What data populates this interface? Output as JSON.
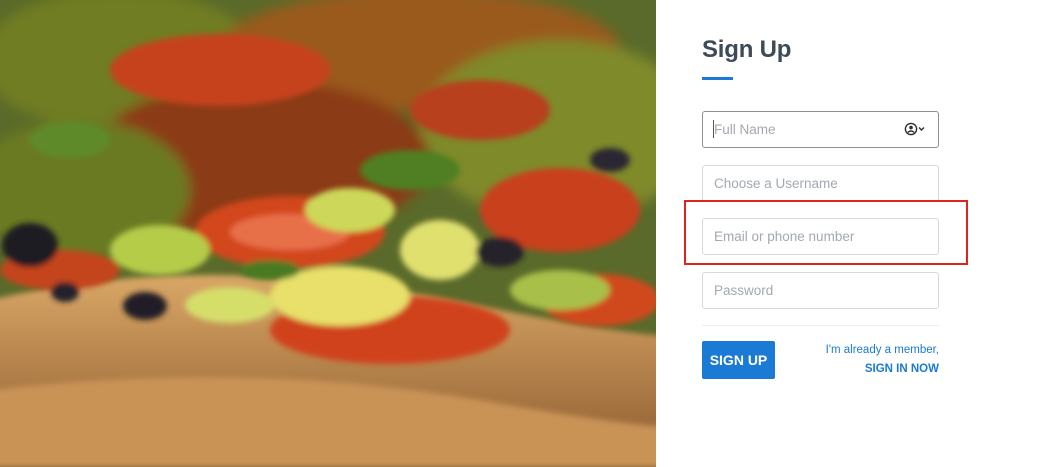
{
  "page": {
    "title": "Sign Up"
  },
  "form": {
    "full_name": {
      "placeholder": "Full Name",
      "value": ""
    },
    "username": {
      "placeholder": "Choose a Username",
      "value": ""
    },
    "email": {
      "placeholder": "Email or phone number",
      "value": ""
    },
    "password": {
      "placeholder": "Password",
      "value": ""
    },
    "submit_label": "SIGN UP"
  },
  "member": {
    "text": "I'm already a member,",
    "signin_label": "SIGN IN NOW"
  },
  "icons": {
    "hero": "pizza-photo",
    "account": "account-circle-icon",
    "dropdown": "chevron-down-icon"
  },
  "colors": {
    "accent": "#1a7ad4",
    "title": "#3d4a57",
    "highlight": "#e0231e"
  }
}
